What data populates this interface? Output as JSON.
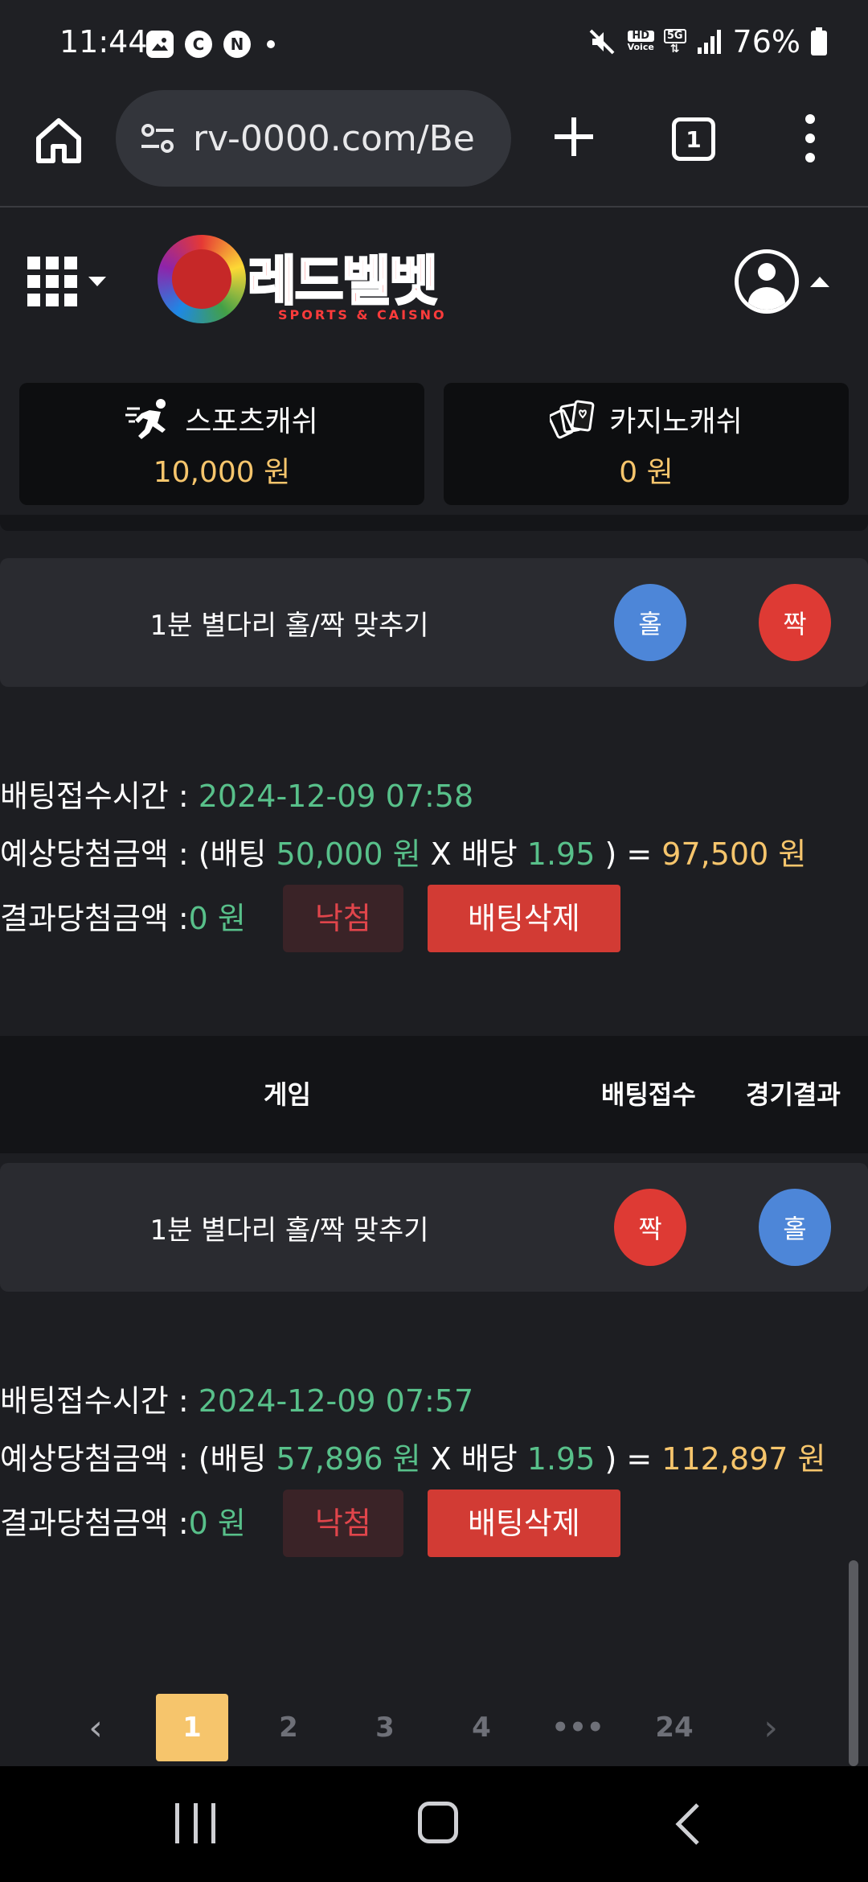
{
  "status_bar": {
    "time": "11:44",
    "battery": "76%",
    "left_icons": [
      "image-icon",
      "c-icon",
      "n-icon",
      "dot-icon"
    ],
    "right_icons": [
      "mute-icon",
      "hd-voice-icon",
      "5g-icon",
      "signal-icon",
      "battery-icon"
    ],
    "hd_label": "HD",
    "voice_label": "Voice",
    "net_label": "5G"
  },
  "browser": {
    "url": "rv-0000.com/Be",
    "tab_count": "1"
  },
  "site": {
    "logo_title": "레드벨벳",
    "logo_subtitle": "SPORTS & CAISNO"
  },
  "cash": {
    "sports_label": "스포츠캐쉬",
    "sports_value": "10,000 원",
    "casino_label": "카지노캐쉬",
    "casino_value": "0 원"
  },
  "bets": [
    {
      "game": "1분 별다리 홀/짝 맞추기",
      "pick": "홀",
      "result": "짝",
      "time_label": "배팅접수시간 : ",
      "time": "2024-12-09 07:58",
      "expected_label": "예상당첨금액 : (배팅 ",
      "bet_amount": "50,000 원",
      "odds_label": " X 배당 ",
      "odds": "1.95",
      "eq_label": " ) = ",
      "expected": "97,500 원",
      "result_label": "결과당첨금액 : ",
      "result_amount": "0 원",
      "status": "낙첨",
      "delete_label": "배팅삭제"
    },
    {
      "game": "1분 별다리 홀/짝 맞추기",
      "pick": "짝",
      "result": "홀",
      "time_label": "배팅접수시간 : ",
      "time": "2024-12-09 07:57",
      "expected_label": "예상당첨금액 : (배팅 ",
      "bet_amount": "57,896 원",
      "odds_label": " X 배당 ",
      "odds": "1.95",
      "eq_label": " ) = ",
      "expected": "112,897 원",
      "result_label": "결과당첨금액 : ",
      "result_amount": "0 원",
      "status": "낙첨",
      "delete_label": "배팅삭제"
    }
  ],
  "table_header": {
    "game": "게임",
    "bet": "배팅접수",
    "result": "경기결과"
  },
  "pagination": {
    "prev": "‹",
    "pages": [
      "1",
      "2",
      "3",
      "4",
      "•••",
      "24"
    ],
    "next": "›",
    "current": "1"
  },
  "colors": {
    "accent_gold": "#f6c56c",
    "green": "#58c08a",
    "red_chip": "#de3a34",
    "blue_chip": "#4d86d8",
    "delete_button": "#d23b34"
  }
}
